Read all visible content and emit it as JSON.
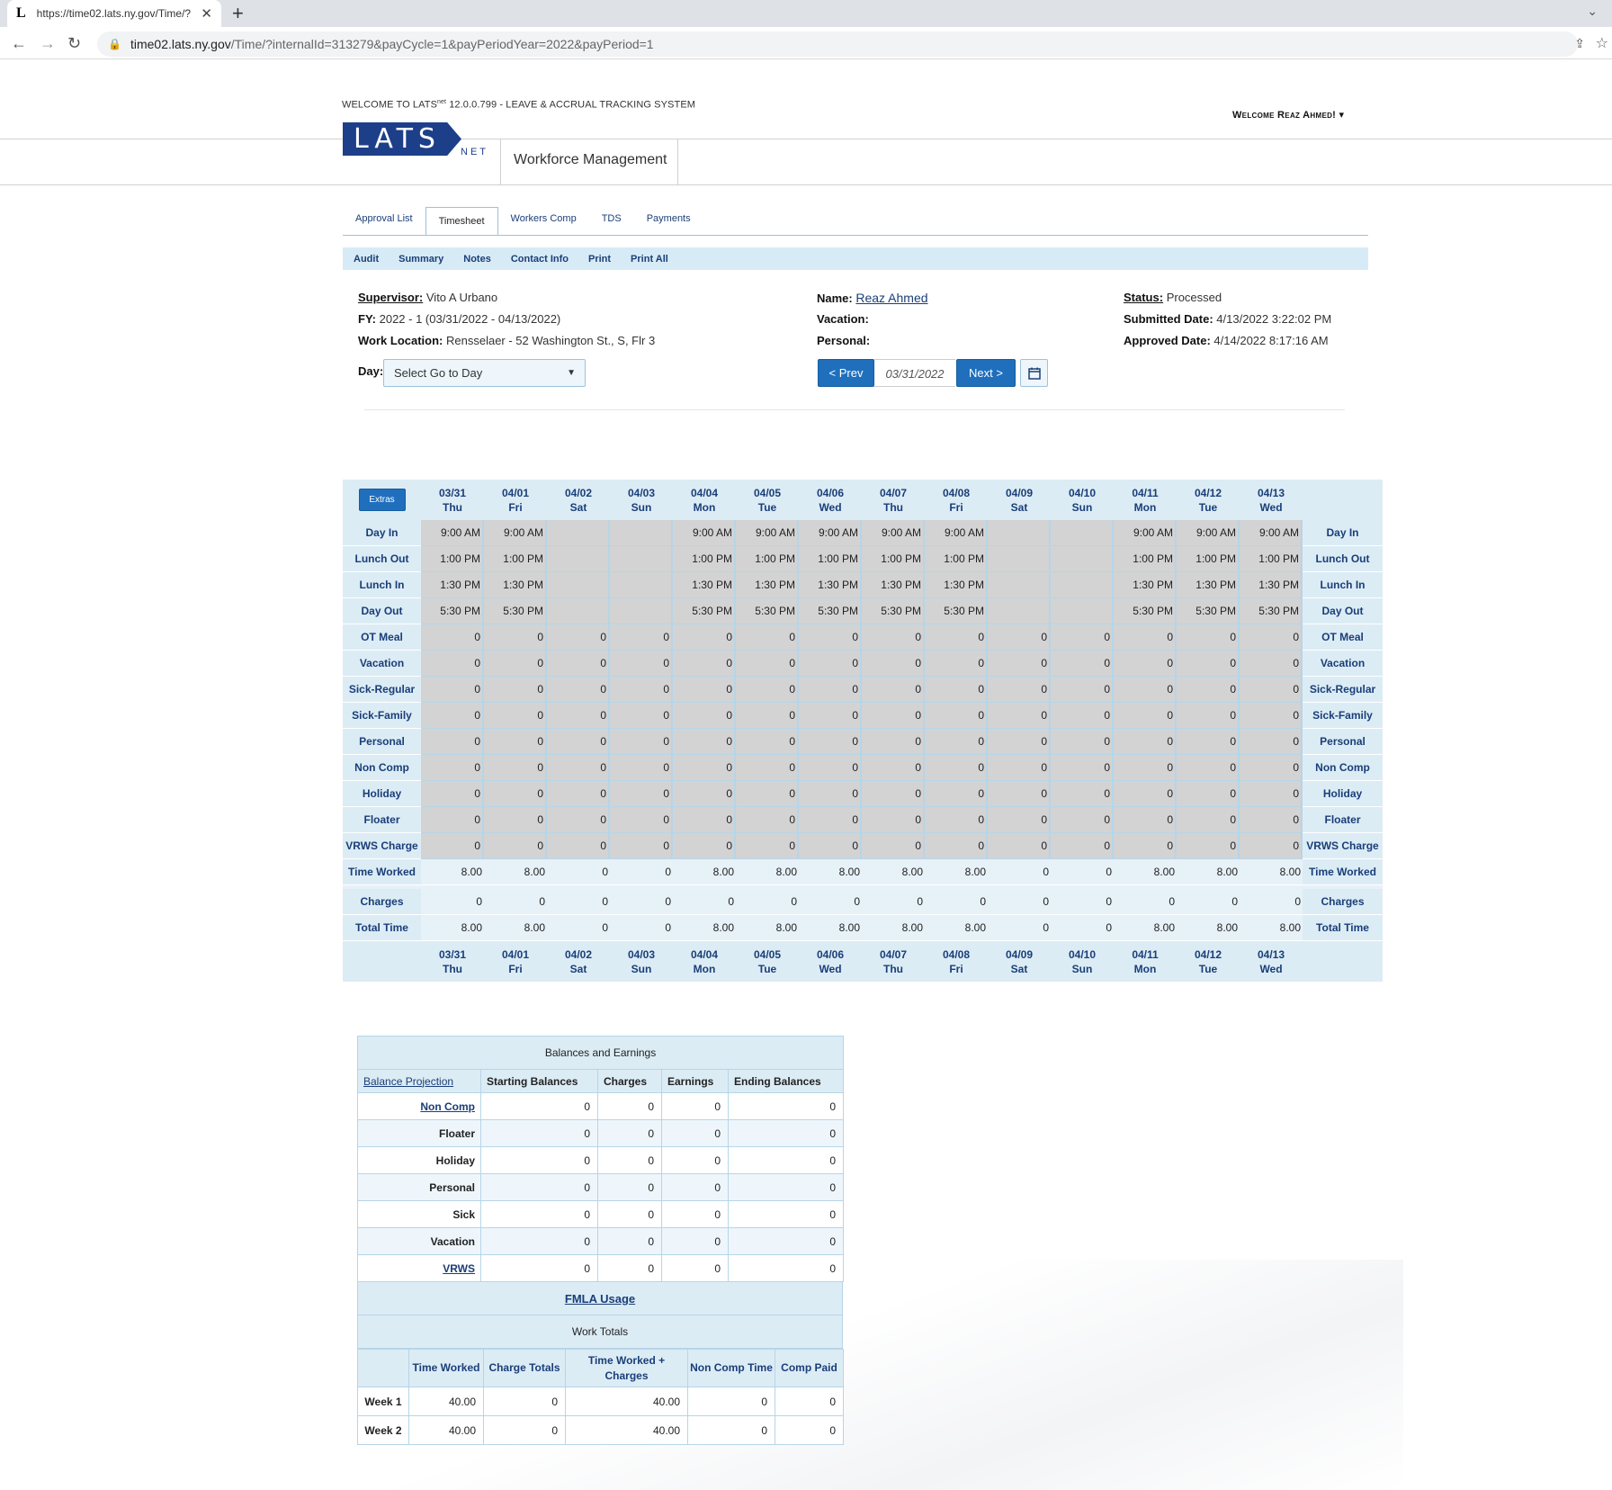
{
  "browser": {
    "tab_title": "https://time02.lats.ny.gov/Time/?",
    "url_host": "time02.lats.ny.gov",
    "url_path": "/Time/?internalId=313279&payCycle=1&payPeriodYear=2022&payPeriod=1"
  },
  "header": {
    "welcome_prefix": "WELCOME TO LATS",
    "welcome_sup": "net",
    "welcome_suffix": " 12.0.0.799 - LEAVE & ACCRUAL TRACKING SYSTEM",
    "user_menu": "Welcome Reaz Ahmed!",
    "logo_text": "LATS",
    "logo_sub": "NET",
    "app_title": "Workforce Management"
  },
  "main_tabs": [
    "Approval List",
    "Timesheet",
    "Workers Comp",
    "TDS",
    "Payments"
  ],
  "sub_nav": [
    "Audit",
    "Summary",
    "Notes",
    "Contact Info",
    "Print",
    "Print All"
  ],
  "info": {
    "supervisor_label": "Supervisor:",
    "supervisor": "Vito A Urbano",
    "fy_label": "FY:",
    "fy": "2022 - 1 (03/31/2022 - 04/13/2022)",
    "work_location_label": "Work Location:",
    "work_location": "Rensselaer - 52 Washington St., S, Flr 3",
    "day_label": "Day:",
    "day_select": "Select Go to Day",
    "name_label": "Name:",
    "name": "Reaz Ahmed",
    "vacation_label": "Vacation:",
    "personal_label": "Personal:",
    "status_label": "Status:",
    "status": "Processed",
    "submitted_label": "Submitted Date:",
    "submitted": "4/13/2022 3:22:02 PM",
    "approved_label": "Approved Date:",
    "approved": "4/14/2022 8:17:16 AM",
    "prev_btn": "< Prev",
    "next_btn": "Next >",
    "current_date": "03/31/2022"
  },
  "timesheet": {
    "extras_btn": "Extras",
    "days": [
      {
        "date": "03/31",
        "dow": "Thu",
        "work": true
      },
      {
        "date": "04/01",
        "dow": "Fri",
        "work": true
      },
      {
        "date": "04/02",
        "dow": "Sat",
        "work": false
      },
      {
        "date": "04/03",
        "dow": "Sun",
        "work": false
      },
      {
        "date": "04/04",
        "dow": "Mon",
        "work": true
      },
      {
        "date": "04/05",
        "dow": "Tue",
        "work": true
      },
      {
        "date": "04/06",
        "dow": "Wed",
        "work": true
      },
      {
        "date": "04/07",
        "dow": "Thu",
        "work": true
      },
      {
        "date": "04/08",
        "dow": "Fri",
        "work": true
      },
      {
        "date": "04/09",
        "dow": "Sat",
        "work": false
      },
      {
        "date": "04/10",
        "dow": "Sun",
        "work": false
      },
      {
        "date": "04/11",
        "dow": "Mon",
        "work": true
      },
      {
        "date": "04/12",
        "dow": "Tue",
        "work": true
      },
      {
        "date": "04/13",
        "dow": "Wed",
        "work": true
      }
    ],
    "time_rows": [
      {
        "label": "Day In",
        "value": "9:00 AM"
      },
      {
        "label": "Lunch Out",
        "value": "1:00 PM"
      },
      {
        "label": "Lunch In",
        "value": "1:30 PM"
      },
      {
        "label": "Day Out",
        "value": "5:30 PM"
      }
    ],
    "charge_rows": [
      "OT Meal",
      "Vacation",
      "Sick-Regular",
      "Sick-Family",
      "Personal",
      "Non Comp",
      "Holiday",
      "Floater",
      "VRWS Charge"
    ],
    "charge_value": "0",
    "time_worked_label": "Time Worked",
    "charges_label": "Charges",
    "total_time_label": "Total Time",
    "worked_value": "8.00",
    "off_value": "0"
  },
  "balances": {
    "title": "Balances and Earnings",
    "projection_link": "Balance Projection",
    "columns": [
      "Starting Balances",
      "Charges",
      "Earnings",
      "Ending Balances"
    ],
    "rows": [
      {
        "label": "Non Comp",
        "link": true,
        "values": [
          "0",
          "0",
          "0",
          "0"
        ]
      },
      {
        "label": "Floater",
        "link": false,
        "values": [
          "0",
          "0",
          "0",
          "0"
        ]
      },
      {
        "label": "Holiday",
        "link": false,
        "values": [
          "0",
          "0",
          "0",
          "0"
        ]
      },
      {
        "label": "Personal",
        "link": false,
        "values": [
          "0",
          "0",
          "0",
          "0"
        ]
      },
      {
        "label": "Sick",
        "link": false,
        "values": [
          "0",
          "0",
          "0",
          "0"
        ]
      },
      {
        "label": "Vacation",
        "link": false,
        "values": [
          "0",
          "0",
          "0",
          "0"
        ]
      },
      {
        "label": "VRWS",
        "link": true,
        "values": [
          "0",
          "0",
          "0",
          "0"
        ]
      }
    ],
    "fmla_link": "FMLA Usage",
    "work_totals_title": "Work Totals",
    "wt_columns": [
      "Time Worked",
      "Charge Totals",
      "Time Worked + Charges",
      "Non Comp Time",
      "Comp Paid"
    ],
    "wt_rows": [
      {
        "label": "Week 1",
        "values": [
          "40.00",
          "0",
          "40.00",
          "0",
          "0"
        ]
      },
      {
        "label": "Week 2",
        "values": [
          "40.00",
          "0",
          "40.00",
          "0",
          "0"
        ]
      }
    ]
  }
}
